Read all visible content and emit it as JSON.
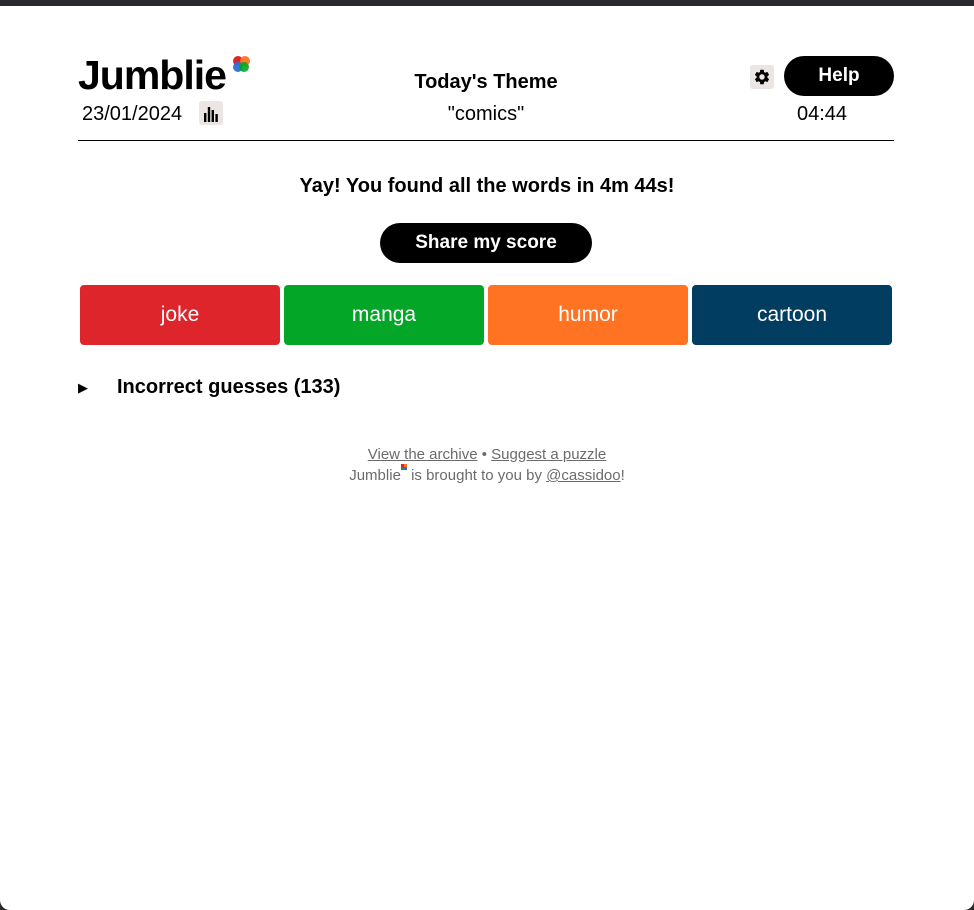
{
  "app": {
    "name": "Jumblie",
    "date": "23/01/2024",
    "timer": "04:44",
    "help_label": "Help",
    "stats_icon": "bar-chart-icon",
    "settings_icon": "gear-icon"
  },
  "theme": {
    "title": "Today's Theme",
    "word": "\"comics\""
  },
  "result": {
    "message": "Yay! You found all the words in 4m 44s!",
    "share_label": "Share my score"
  },
  "words": [
    {
      "text": "joke",
      "color": "#dd252b"
    },
    {
      "text": "manga",
      "color": "#04a628"
    },
    {
      "text": "humor",
      "color": "#ff7323"
    },
    {
      "text": "cartoon",
      "color": "#003d60"
    }
  ],
  "incorrect": {
    "label": "Incorrect guesses (133)"
  },
  "footer": {
    "archive_link": "View the archive",
    "separator": "•",
    "suggest_link": "Suggest a puzzle",
    "brand": "Jumblie",
    "brought_by": "is brought to you by",
    "author_link": "@cassidoo",
    "trailing": "!"
  },
  "colors": {
    "logo_red": "#dd252b",
    "logo_green": "#04a628",
    "logo_orange": "#ff7323",
    "logo_blue": "#2f6fd1"
  }
}
